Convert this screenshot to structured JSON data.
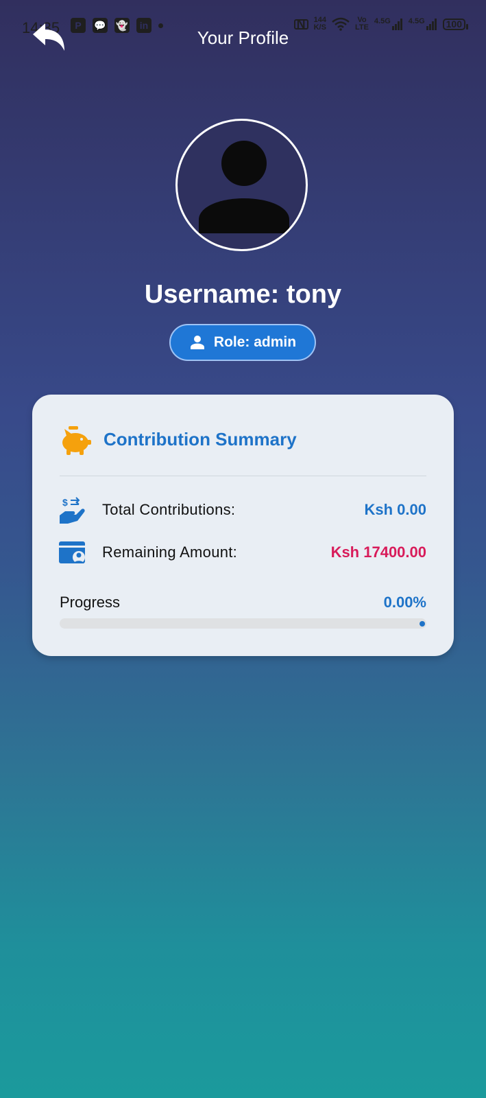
{
  "status_bar": {
    "time": "14:35",
    "apps": [
      "P",
      "💬",
      "👻",
      "in"
    ],
    "net_speed_value": "144",
    "net_speed_unit": "K/S",
    "volte_top": "Vo",
    "volte_bottom": "LTE",
    "network_1": "4.5G",
    "network_2": "4.5G",
    "battery": "100"
  },
  "header": {
    "title": "Your Profile",
    "back_icon": "back-arrow-icon"
  },
  "profile": {
    "username": "Username: tony",
    "role": "Role: admin",
    "avatar_icon": "person-icon"
  },
  "summary": {
    "title": "Contribution Summary",
    "title_icon": "piggy-bank-icon",
    "total_label": "Total Contributions:",
    "total_value": "Ksh 0.00",
    "total_icon": "money-hand-icon",
    "remaining_label": "Remaining Amount:",
    "remaining_value": "Ksh 17400.00",
    "remaining_icon": "wallet-person-icon",
    "progress_label": "Progress",
    "progress_value": "0.00%",
    "progress_fraction": 0.0
  },
  "colors": {
    "accent": "#1e73c8",
    "pink": "#d81b5a",
    "orange": "#f5a10d",
    "card_bg": "#e9eef4"
  }
}
